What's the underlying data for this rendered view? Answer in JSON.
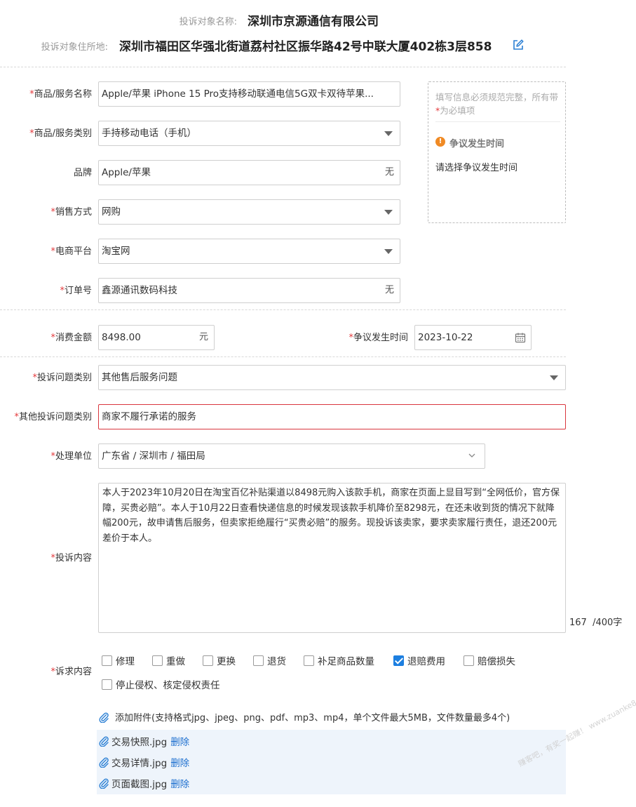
{
  "header": {
    "name_label": "投诉对象名称:",
    "name_value": "深圳市京源通信有限公司",
    "address_label": "投诉对象住所地:",
    "address_value": "深圳市福田区华强北街道荔村社区振华路42号中联大厦402栋3层858",
    "edit_icon": "edit-icon"
  },
  "required_mark": "*",
  "fields": {
    "product_name": {
      "label": "商品/服务名称",
      "value": "Apple/苹果 iPhone 15 Pro支持移动联通电信5G双卡双待苹果..."
    },
    "product_category": {
      "label": "商品/服务类别",
      "value": "手持移动电话（手机）"
    },
    "brand": {
      "label": "品牌",
      "value": "Apple/苹果",
      "suffix": "无"
    },
    "sales_method": {
      "label": "销售方式",
      "value": "网购"
    },
    "platform": {
      "label": "电商平台",
      "value": "淘宝网"
    },
    "order_no": {
      "label": "订单号",
      "value": "鑫源通讯数码科技",
      "suffix": "无"
    },
    "amount": {
      "label": "消费金额",
      "value": "8498.00",
      "suffix": "元"
    },
    "dispute_date": {
      "label": "争议发生时间",
      "value": "2023-10-22"
    },
    "complaint_category": {
      "label": "投诉问题类别",
      "value": "其他售后服务问题"
    },
    "other_category": {
      "label": "其他投诉问题类别",
      "value": "商家不履行承诺的服务"
    },
    "handling_unit": {
      "label": "处理单位",
      "value": "广东省 / 深圳市 / 福田局"
    },
    "complaint_content": {
      "label": "投诉内容",
      "value": "本人于2023年10月20日在淘宝百亿补贴渠道以8498元购入该款手机，商家在页面上显目写到“全网低价，官方保障，买贵必赔”。本人于10月22日查看快递信息的时候发现该款手机降价至8298元，在还未收到货的情况下就降幅200元，故申请售后服务，但卖家拒绝履行“买贵必赔”的服务。现投诉该卖家，要求卖家履行责任，退还200元差价于本人。",
      "count": "167",
      "max": "/400字"
    },
    "demands": {
      "label": "诉求内容",
      "options": [
        {
          "label": "修理",
          "checked": false
        },
        {
          "label": "重做",
          "checked": false
        },
        {
          "label": "更换",
          "checked": false
        },
        {
          "label": "退货",
          "checked": false
        },
        {
          "label": "补足商品数量",
          "checked": false
        },
        {
          "label": "退赔费用",
          "checked": true
        },
        {
          "label": "赔偿损失",
          "checked": false
        },
        {
          "label": "停止侵权、核定侵权责任",
          "checked": false
        }
      ]
    }
  },
  "tip_box": {
    "note_prefix": "填写信息必须规范完整，所有带",
    "note_star": "*",
    "note_suffix": "为必填项",
    "warn_icon": "!",
    "heading": "争议发生时间",
    "body": "请选择争议发生时间"
  },
  "attachments": {
    "add_label": "添加附件(支持格式jpg、jpeg、png、pdf、mp3、mp4，单个文件最大5MB，文件数量最多4个)",
    "delete_label": "删除",
    "files": [
      "交易快照.jpg",
      "交易详情.jpg",
      "页面截图.jpg"
    ]
  },
  "watermark": "赚客吧，有奖一起赚！ www.zuanke8.com",
  "colors": {
    "required": "#e4393c",
    "error_border": "#d9363e",
    "checkbox_on": "#1d7fe0",
    "link": "#1d6fcf",
    "attach_bg": "#eef4fb"
  }
}
